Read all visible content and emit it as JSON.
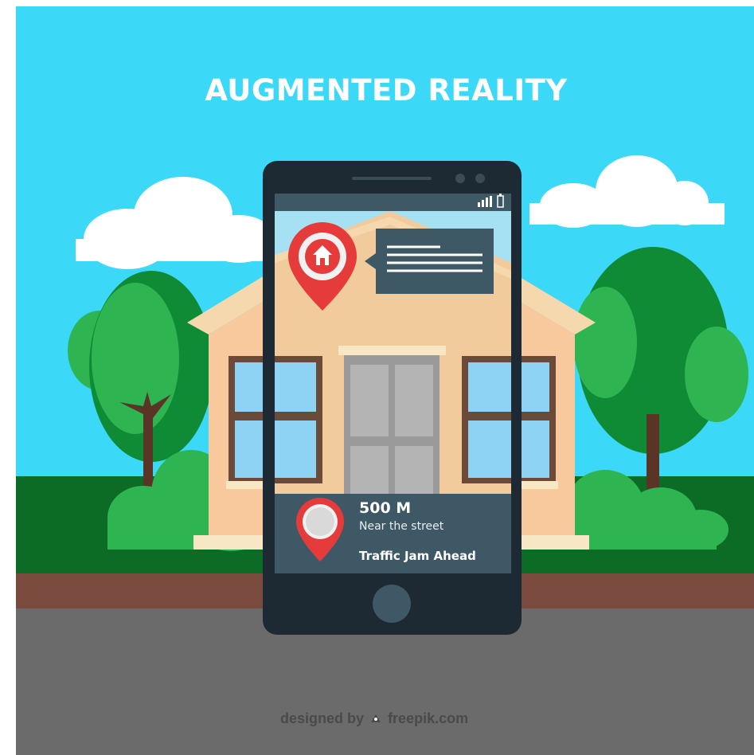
{
  "title": "AUGMENTED REALITY",
  "phone": {
    "distance": "500 M",
    "location_note": "Near the street",
    "alert": "Traffic Jam Ahead"
  },
  "credit": {
    "prefix": "designed by",
    "site": "freepik.com"
  },
  "colors": {
    "sky": "#3cd8f7",
    "grass": "#0c6b24",
    "soil": "#7b4a3e",
    "road": "#6b6b6b",
    "phone_body": "#1e2a33",
    "screen_panel": "#3f5865",
    "pin_red": "#e53b3b",
    "house_wall": "#f7c99c"
  },
  "icons": [
    "house-pin-icon",
    "location-pin-icon",
    "signal-icon",
    "battery-icon",
    "freepik-logo-icon"
  ]
}
